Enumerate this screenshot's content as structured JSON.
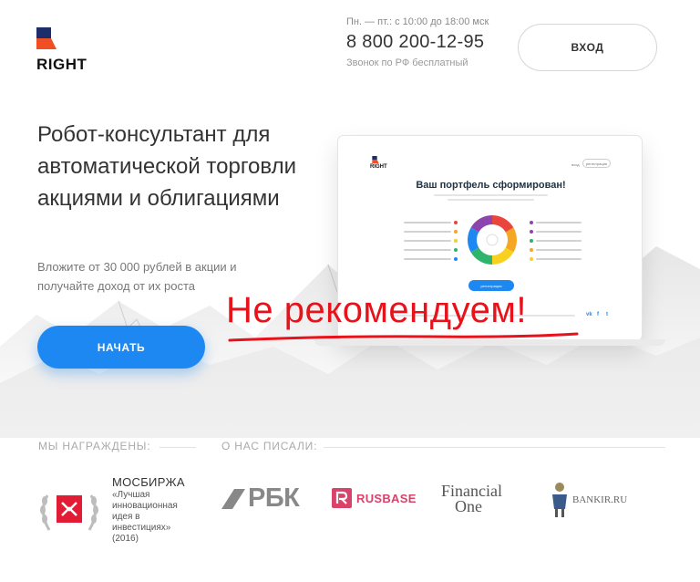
{
  "brand": {
    "name": "RIGHT"
  },
  "contact": {
    "hours": "Пн. — пт.: с 10:00 до 18:00 мск",
    "phone": "8 800 200-12-95",
    "note": "Звонок по РФ бесплатный"
  },
  "header": {
    "login_label": "ВХОД"
  },
  "hero": {
    "title": "Робот-консультант для автоматической торговли акциями и облигациями",
    "subtitle": "Вложите от 30 000 рублей в акции и получайте доход от их роста",
    "cta_label": "НАЧАТЬ"
  },
  "preview": {
    "brand": "RIGHT",
    "enter": "вход",
    "register": "регистрация",
    "title": "Ваш портфель сформирован!",
    "cta": "регистрация",
    "portfolio_colors": [
      "#e9453c",
      "#f5a623",
      "#f8d11f",
      "#2fb36d",
      "#1e88f2",
      "#8e44ad"
    ]
  },
  "overlay": {
    "text": "Не рекомендуем!",
    "color": "#e8121b"
  },
  "awards": {
    "label": "МЫ НАГРАЖДЕНЫ:",
    "title": "МОСБИРЖА",
    "description": "«Лучшая инновационная идея в инвестициях» (2016)"
  },
  "press": {
    "label": "О НАС ПИСАЛИ:",
    "logos": {
      "rbk": "РБК",
      "rusbase": "RUSBASE",
      "financial_one_line1": "Financial",
      "financial_one_line2": "One",
      "bankir": "BANKIR.RU"
    }
  },
  "colors": {
    "accent": "#1e88f2",
    "brand_orange": "#f04e23",
    "brand_navy": "#1c2d6b"
  }
}
